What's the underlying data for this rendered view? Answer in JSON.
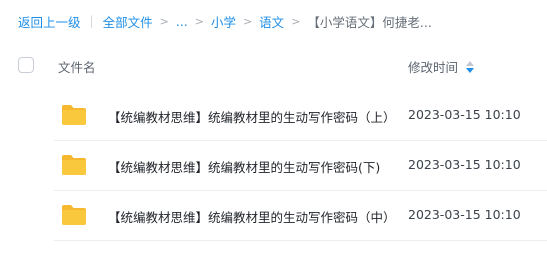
{
  "breadcrumb": {
    "back": "返回上一级",
    "all_files": "全部文件",
    "ellipsis": "...",
    "level1": "小学",
    "level2": "语文",
    "current": "【小学语文】何捷老..."
  },
  "table": {
    "col_name": "文件名",
    "col_time": "修改时间"
  },
  "files": [
    {
      "name": "【统编教材思维】统编教材里的生动写作密码（上）",
      "time": "2023-03-15 10:10"
    },
    {
      "name": "【统编教材思维】统编教材里的生动写作密码(下)",
      "time": "2023-03-15 10:10"
    },
    {
      "name": "【统编教材思维】统编教材里的生动写作密码（中）",
      "time": "2023-03-15 10:10"
    }
  ],
  "colors": {
    "link": "#1f8fe8",
    "folder": "#f9c83c",
    "sort_active": "#1f8fe8"
  },
  "icons": {
    "folder": "folder-icon",
    "sort": "sort-icon"
  }
}
